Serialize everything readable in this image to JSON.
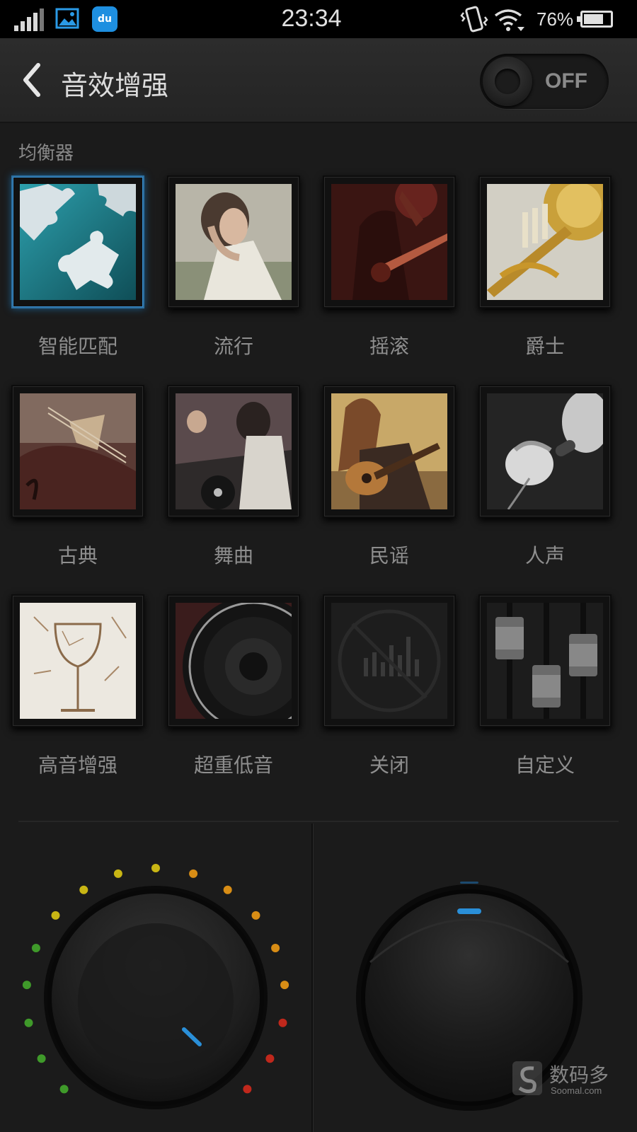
{
  "status_bar": {
    "time": "23:34",
    "battery_percent_text": "76%",
    "battery_level": 0.76,
    "icons": [
      "signal-icon",
      "gallery-icon",
      "baidu-du-icon",
      "vibrate-icon",
      "wifi-icon",
      "battery-icon"
    ],
    "du_label": "du"
  },
  "header": {
    "title": "音效增强",
    "toggle_label": "OFF",
    "toggle_on": false
  },
  "equalizer": {
    "section_label": "均衡器",
    "presets": [
      {
        "label": "智能匹配",
        "selected": true
      },
      {
        "label": "流行",
        "selected": false
      },
      {
        "label": "摇滚",
        "selected": false
      },
      {
        "label": "爵士",
        "selected": false
      },
      {
        "label": "古典",
        "selected": false
      },
      {
        "label": "舞曲",
        "selected": false
      },
      {
        "label": "民谣",
        "selected": false
      },
      {
        "label": "人声",
        "selected": false
      },
      {
        "label": "高音增强",
        "selected": false
      },
      {
        "label": "超重低音",
        "selected": false
      },
      {
        "label": "关闭",
        "selected": false
      },
      {
        "label": "自定义",
        "selected": false
      }
    ]
  },
  "watermark": {
    "text": "数码多",
    "sub": "Soomal.com"
  },
  "colors": {
    "accent_blue": "#2a8fd8",
    "led_green": "#3f9a2a",
    "led_yellow": "#c9b614",
    "led_orange": "#d88d15",
    "led_red": "#c0281c"
  }
}
